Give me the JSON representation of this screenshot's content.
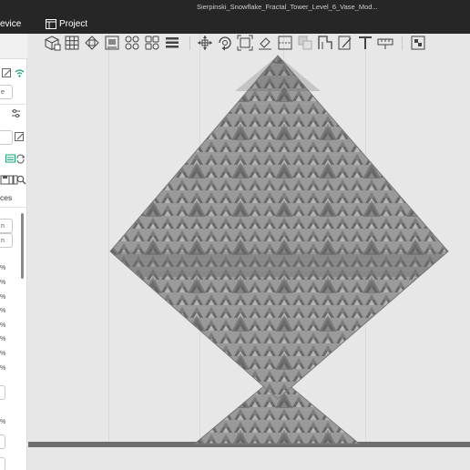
{
  "window": {
    "title": "Sierpinski_Snowflake_Fractal_Tower_Level_6_Vase_Mod..."
  },
  "tabs": {
    "device_label": "evice",
    "project_label": "Project"
  },
  "sidebar": {
    "fields": [
      "e",
      "",
      "",
      "n",
      "n"
    ],
    "percent_rows": [
      "%",
      "%",
      "%",
      "%",
      "%",
      "%",
      "%",
      "%",
      "%"
    ],
    "section_label": "ces"
  },
  "toolbar": {
    "buttons": [
      "add-cube-icon",
      "arrange-grid-icon",
      "orient-icon",
      "auto-orient-icon",
      "split-objects-icon",
      "split-parts-icon",
      "layers-icon",
      "move-icon",
      "rotate-icon",
      "scale-icon",
      "paint-icon",
      "cut-icon",
      "boolean-icon",
      "support-paint-icon",
      "seam-paint-icon",
      "text-icon",
      "measure-icon",
      "assemble-icon"
    ]
  },
  "model": {
    "name": "Sierpinski Snowflake Fractal Tower",
    "color": "#8f8f8f",
    "dark": "#5a5a5a",
    "light": "#b9b9b9"
  }
}
